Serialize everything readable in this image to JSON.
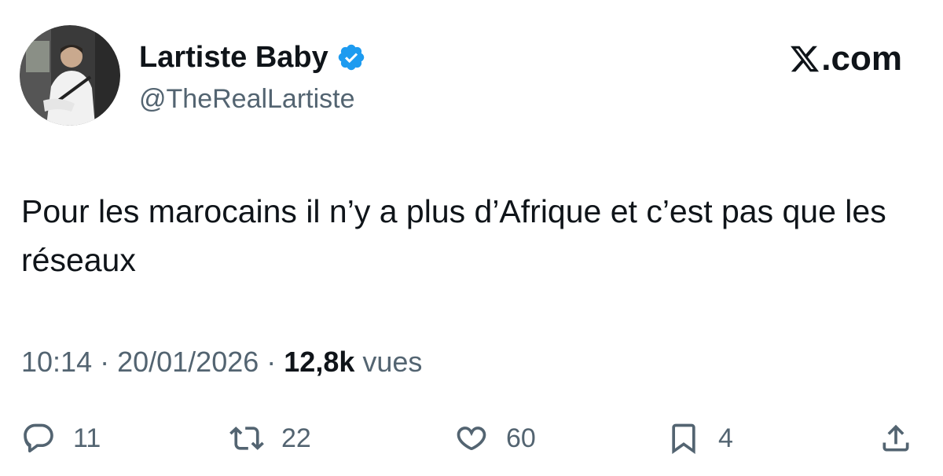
{
  "author": {
    "display_name": "Lartiste Baby",
    "handle": "@TheRealLartiste",
    "verified": true,
    "verified_color": "#1d9bf0"
  },
  "brand": {
    "label": ".com"
  },
  "tweet": {
    "text": "Pour les marocains il n’y a plus d’Afrique et c’est pas que les réseaux"
  },
  "meta": {
    "time": "10:14",
    "separator1": " · ",
    "date": "20/01/2026",
    "separator2": " · ",
    "views_count": "12,8k",
    "views_label": " vues"
  },
  "actions": {
    "reply": {
      "icon": "reply-icon",
      "count": "11"
    },
    "repost": {
      "icon": "repost-icon",
      "count": "22"
    },
    "like": {
      "icon": "heart-icon",
      "count": "60"
    },
    "bookmark": {
      "icon": "bookmark-icon",
      "count": "4"
    },
    "share": {
      "icon": "share-icon"
    }
  },
  "colors": {
    "text": "#0f1419",
    "secondary": "#536471",
    "icon": "#536471"
  }
}
